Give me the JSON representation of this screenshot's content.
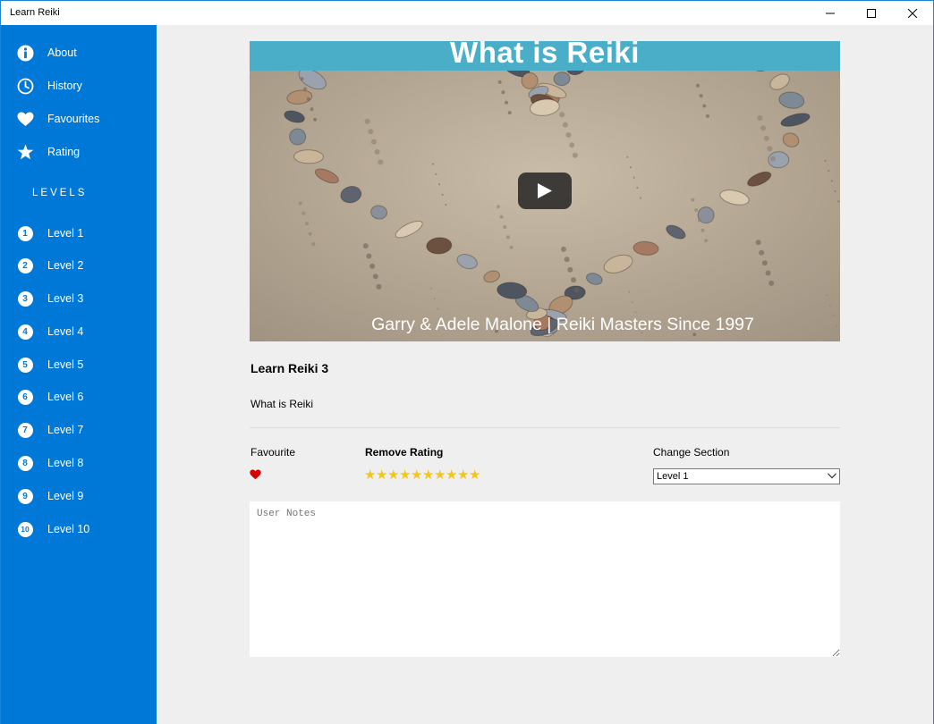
{
  "window": {
    "title": "Learn Reiki",
    "accent": "#0078d7"
  },
  "sidebar": {
    "items": [
      {
        "label": "About",
        "icon": "info-icon"
      },
      {
        "label": "History",
        "icon": "clock-icon"
      },
      {
        "label": "Favourites",
        "icon": "heart-icon"
      },
      {
        "label": "Rating",
        "icon": "star-icon"
      }
    ],
    "levels_heading": "LEVELS",
    "levels": [
      {
        "number": "1",
        "label": "Level 1"
      },
      {
        "number": "2",
        "label": "Level 2"
      },
      {
        "number": "3",
        "label": "Level 3"
      },
      {
        "number": "4",
        "label": "Level 4"
      },
      {
        "number": "5",
        "label": "Level 5"
      },
      {
        "number": "6",
        "label": "Level 6"
      },
      {
        "number": "7",
        "label": "Level 7"
      },
      {
        "number": "8",
        "label": "Level 8"
      },
      {
        "number": "9",
        "label": "Level 9"
      },
      {
        "number": "10",
        "label": "Level 10"
      }
    ]
  },
  "video": {
    "title": "What is Reiki",
    "caption": "Garry & Adele Malone | Reiki Masters Since 1997",
    "play_icon": "play-icon"
  },
  "lesson": {
    "title": "Learn Reiki 3",
    "subtitle": "What is Reiki"
  },
  "controls": {
    "favourite_label": "Favourite",
    "favourite_color": "#d40000",
    "rating_label": "Remove Rating",
    "star_count": 10,
    "star_color": "#f5c518",
    "section_label": "Change Section",
    "section_value": "Level 1"
  },
  "notes": {
    "placeholder": "User Notes"
  }
}
